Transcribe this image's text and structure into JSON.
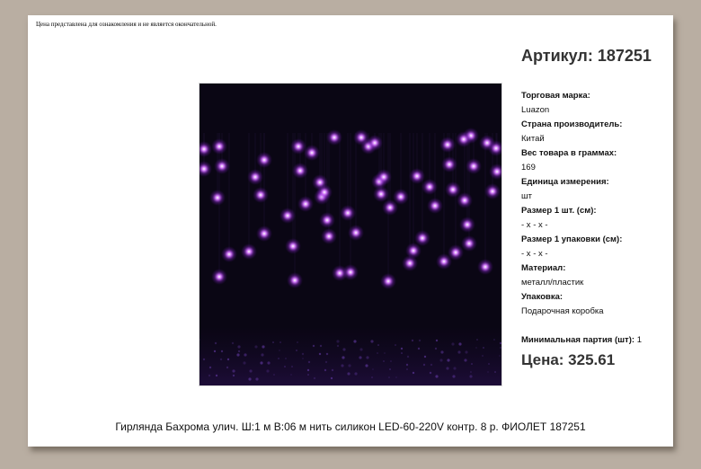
{
  "disclaimer": "Цена представлена для ознакомления и не является окончательной.",
  "article": "Артикул: 187251",
  "specs": [
    {
      "label": "Торговая марка:",
      "value": "Luazon"
    },
    {
      "label": "Страна производитель:",
      "value": "Китай"
    },
    {
      "label": "Вес товара в граммах:",
      "value": "169"
    },
    {
      "label": "Единица измерения:",
      "value": "шт"
    },
    {
      "label": "Размер 1 шт. (см):",
      "value": "- x - x -"
    },
    {
      "label": "Размер 1 упаковки (см):",
      "value": "- x - x -"
    },
    {
      "label": "Материал:",
      "value": "металл/пластик"
    },
    {
      "label": "Упаковка:",
      "value": "Подарочная коробка"
    }
  ],
  "min_lot": {
    "label": "Минимальная партия (шт):",
    "value": "1"
  },
  "price": "Цена: 325.61",
  "product_title": "Гирлянда Бахрома улич. Ш:1 м В:06 м нить силикон LED-60-220V контр. 8 р. ФИОЛЕТ 187251",
  "photo": {
    "icon": "product-photo-led-curtain",
    "light_color": "#c45cff",
    "background": "#0a0614"
  }
}
